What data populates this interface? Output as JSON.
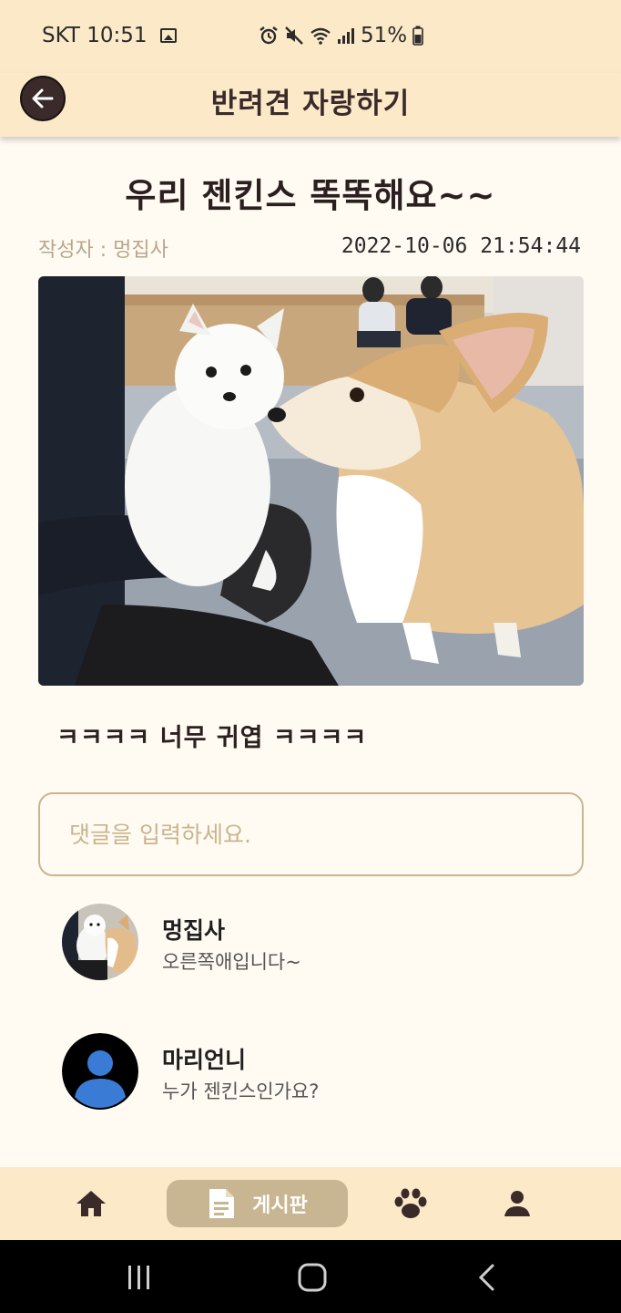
{
  "status_bar": {
    "carrier_time": "SKT 10:51",
    "battery": "51%"
  },
  "app_bar": {
    "title": "반려견 자랑하기"
  },
  "post": {
    "title": "우리 젠킨스 똑똑해요~~",
    "author": "작성자 : 멍집사",
    "datetime": "2022-10-06 21:54:44",
    "body": "ㅋㅋㅋㅋ 너무 귀엽 ㅋㅋㅋㅋ"
  },
  "comment_input": {
    "placeholder": "댓글을 입력하세요.",
    "value": ""
  },
  "comments": [
    {
      "name": "멍집사",
      "text": "오른쪽애입니다~"
    },
    {
      "name": "마리언니",
      "text": "누가 젠킨스인가요?"
    }
  ],
  "bottom_nav": {
    "items": [
      {
        "icon": "home-icon"
      },
      {
        "icon": "document-icon",
        "label": "게시판",
        "active": true
      },
      {
        "icon": "paw-icon"
      },
      {
        "icon": "person-icon"
      }
    ]
  },
  "colors": {
    "header_bg": "#fbe9c8",
    "page_bg": "#fffbf2",
    "accent": "#c8b591",
    "back_button": "#3a2a2a",
    "avatar_default": "#3a7bd5"
  }
}
